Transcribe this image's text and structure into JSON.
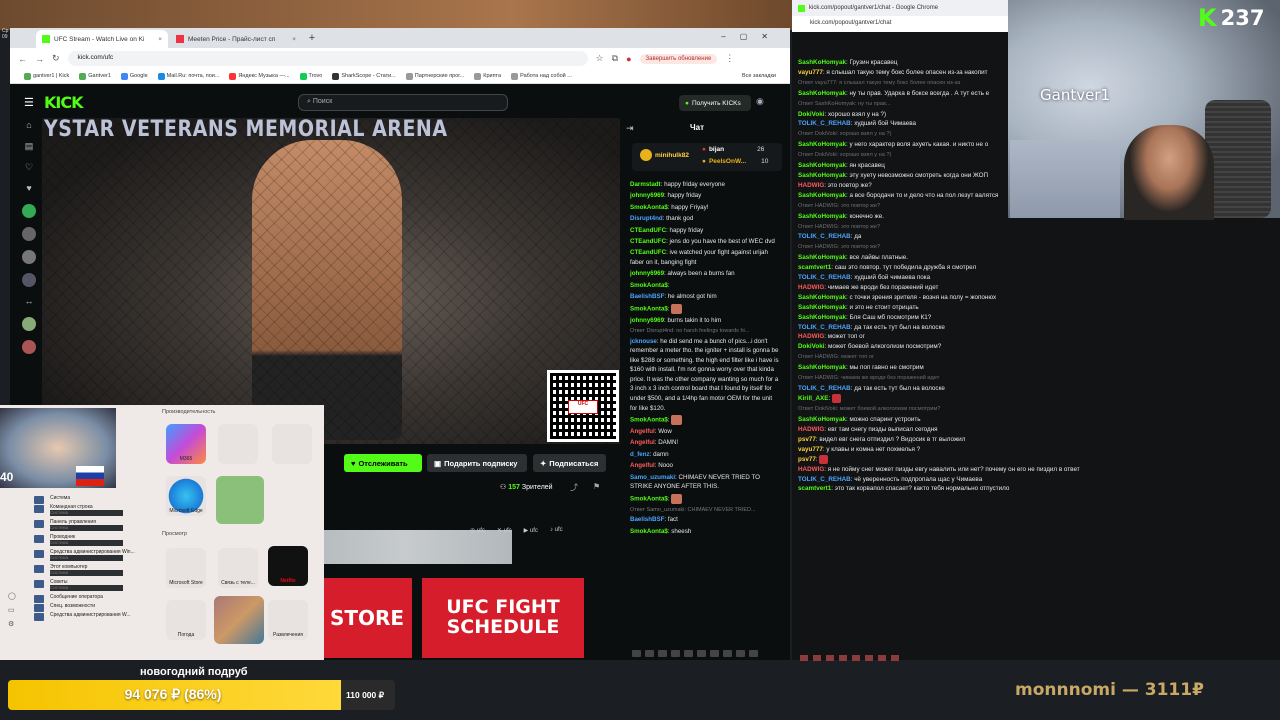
{
  "desktop": {
    "clock_line1": "Ср",
    "clock_line2": "09"
  },
  "browser": {
    "tabs": [
      {
        "label": "UFC Stream - Watch Live on Ki",
        "active": true
      },
      {
        "label": "Meeten Price - Прайс-лист сп",
        "active": false
      }
    ],
    "url": "kick.com/ufc",
    "update_button": "Завершить обновление",
    "bookmarks": [
      "gantver1 | Kick",
      "Gantver1",
      "Google",
      "Mail.Ru: почта, пои...",
      "Яндекс Музыка —...",
      "Trovo",
      "SharkScope - Стати...",
      "Партнерские прог...",
      "Крипта",
      "Работа над собой ..."
    ],
    "all_bookmarks": "Все закладки"
  },
  "kick": {
    "logo": "KICK",
    "search_placeholder": "Поиск",
    "get_kicks": "Получить KICKs",
    "get_kicks_brand": "KICKs",
    "arena_text": "YSTAR VETERANS MEMORIAL ARENA",
    "follow": "Отслеживать",
    "gift_sub": "Подарить подписку",
    "subscribe": "Подписаться",
    "viewers_count": "157",
    "viewers_label": "Зрителей",
    "socials": [
      "ufc",
      "ufc",
      "ufc",
      "ufc"
    ],
    "banner_store": "STORE",
    "banner_schedule": "UFC FIGHT SCHEDULE",
    "chat_title": "Чат",
    "gifters": [
      {
        "name": "minihulk82",
        "count": ""
      },
      {
        "name": "bijan",
        "count": "26"
      },
      {
        "name": "PeelsOnW...",
        "count": "10"
      }
    ],
    "messages": [
      {
        "user": "Darmstadt",
        "color": "#53fc18",
        "text": "happy friday everyone"
      },
      {
        "user": "johnny6969",
        "color": "#53fc18",
        "text": "happy friday"
      },
      {
        "user": "SmokAonta$",
        "color": "#53fc18",
        "text": "happy Friyay!"
      },
      {
        "user": "Disrupt4nd",
        "color": "#4aa6ff",
        "text": "thank god"
      },
      {
        "user": "CTEandUFC",
        "color": "#53fc18",
        "text": "happy friday"
      },
      {
        "user": "CTEandUFC",
        "color": "#53fc18",
        "text": "jens do you have the best of WEC dvd"
      },
      {
        "user": "CTEandUFC",
        "color": "#53fc18",
        "text": "ive watched your fight against urijah faber on it, banging fight"
      },
      {
        "user": "johnny6969",
        "color": "#53fc18",
        "text": "always been a burns fan"
      },
      {
        "user": "SmokAonta$",
        "color": "#53fc18",
        "text": ""
      },
      {
        "user": "BaelishBSF",
        "color": "#4aa6ff",
        "text": "he almost got him"
      },
      {
        "user": "SmokAonta$",
        "color": "#53fc18",
        "text": "",
        "emote": true
      },
      {
        "user": "johnny6969",
        "color": "#53fc18",
        "text": "burns takin it to him"
      },
      {
        "reply": "Ответ Disrupt4nd: no harsh feelings towards hi...",
        "user": "jcknouse",
        "color": "#4aa6ff",
        "text": "he did send me a bunch of pics...i don't remember a meter tho. the igniter + install is gonna be like $288 or something. the high end filter like i have is $160 with install. I'm not gonna worry over that kinda price. It was the other company wanting so much for a 3 inch x 3 inch control board that I found by itself for under $500, and a 1/4hp fan motor OEM for the unit for like $120."
      },
      {
        "user": "SmokAonta$",
        "color": "#53fc18",
        "text": "",
        "emote": true
      },
      {
        "user": "Angelful",
        "color": "#ff5a5a",
        "text": "Wow"
      },
      {
        "user": "Angelful",
        "color": "#ff5a5a",
        "text": "DAMN!"
      },
      {
        "user": "d_fenz",
        "color": "#4aa6ff",
        "text": "damn"
      },
      {
        "user": "Angelful",
        "color": "#ff5a5a",
        "text": "Nooo"
      },
      {
        "user": "Samo_uzumaki",
        "color": "#4aa6ff",
        "text": "CHIMAEV NEVER TRIED TO STRIKE ANYONE AFTER THIS."
      },
      {
        "user": "SmokAonta$",
        "color": "#53fc18",
        "text": "",
        "emote": true
      },
      {
        "reply": "Ответ Samo_uzumaki: CHIMAEV NEVER TRIED...",
        "user": "BaelishBSF",
        "color": "#4aa6ff",
        "text": "fact"
      },
      {
        "user": "SmokAonta$",
        "color": "#53fc18",
        "text": "sheesh"
      }
    ]
  },
  "popout": {
    "window_title": "kick.com/popout/gantver1/chat - Google Chrome",
    "url": "kick.com/popout/gantver1/chat",
    "messages": [
      {
        "user": "SashKoHomyak",
        "color": "#53fc18",
        "text": "Грузин красавец"
      },
      {
        "user": "vayu777",
        "color": "#ffd23f",
        "text": "я слышал такую тему бокс более опасен из-за накопит"
      },
      {
        "reply": "Ответ vayu777: я слышал такую тему бокс более опасен из-за"
      },
      {
        "user": "SashKoHomyak",
        "color": "#53fc18",
        "text": "ну ты прав. Ударка в боксе всегда . А тут есть е"
      },
      {
        "reply": "Ответ SashKoHomyak: ну ты прав..."
      },
      {
        "user": "DokiVoki",
        "color": "#53fc18",
        "text": "хорошо взял у на ?)"
      },
      {
        "user": "TOLIK_C_REHAB",
        "color": "#4aa6ff",
        "text": "худший бой Чимаева"
      },
      {
        "reply": "Ответ DokiVoki: хорошо взял у на ?)"
      },
      {
        "user": "SashKoHomyak",
        "color": "#53fc18",
        "text": "у него характер воля ахуеть какая. и никто не о"
      },
      {
        "reply": "Ответ DokiVoki: хорошо взял у на ?)"
      },
      {
        "user": "SashKoHomyak",
        "color": "#53fc18",
        "text": "ян красавец"
      },
      {
        "user": "SashKoHomyak",
        "color": "#53fc18",
        "text": "эту хуету невозможно смотреть когда они ЖОП"
      },
      {
        "user": "HADWIG",
        "color": "#ff5a5a",
        "text": "это повтор же?"
      },
      {
        "user": "SashKoHomyak",
        "color": "#53fc18",
        "text": "а все бородачи то и дело что на пол лезут валятся"
      },
      {
        "reply": "Ответ HADWIG: это повтор же?"
      },
      {
        "user": "SashKoHomyak",
        "color": "#53fc18",
        "text": "конечно же."
      },
      {
        "reply": "Ответ HADWIG: это повтор же?"
      },
      {
        "user": "TOLIK_C_REHAB",
        "color": "#4aa6ff",
        "text": "да"
      },
      {
        "reply": "Ответ HADWIG: это повтор же?"
      },
      {
        "user": "SashKoHomyak",
        "color": "#53fc18",
        "text": "все лайвы платные."
      },
      {
        "user": "scamtvert1",
        "color": "#53fc18",
        "text": "саш это повтор. тут победила дружба я смотрел"
      },
      {
        "user": "TOLIK_C_REHAB",
        "color": "#4aa6ff",
        "text": "худший бой чимаева пока"
      },
      {
        "user": "HADWIG",
        "color": "#ff5a5a",
        "text": "чимаев же вроди без поражений идет"
      },
      {
        "user": "SashKoHomyak",
        "color": "#53fc18",
        "text": "с точки зрения зрителя - возня на полу = жопонюх"
      },
      {
        "user": "SashKoHomyak",
        "color": "#53fc18",
        "text": "и это не стоит отрицать"
      },
      {
        "user": "SashKoHomyak",
        "color": "#53fc18",
        "text": "Бля Саш мб посмотрим К1?"
      },
      {
        "user": "TOLIK_C_REHAB",
        "color": "#4aa6ff",
        "text": "да так есть тут был на волоске"
      },
      {
        "user": "HADWIG",
        "color": "#ff5a5a",
        "text": "может топ ог"
      },
      {
        "user": "DokiVoki",
        "color": "#53fc18",
        "text": "может боевой алкоголизм посмотрим?"
      },
      {
        "reply": "Ответ HADWIG: может топ ог"
      },
      {
        "user": "SashKoHomyak",
        "color": "#53fc18",
        "text": "мы поп гавно не смотрим"
      },
      {
        "reply": "Ответ HADWIG: чимаев же вроди без поражений идет"
      },
      {
        "user": "TOLIK_C_REHAB",
        "color": "#4aa6ff",
        "text": "да так есть тут был на волоске"
      },
      {
        "user": "Kirill_AXE",
        "color": "#53fc18",
        "text": "",
        "emote": true
      },
      {
        "reply": "Ответ DokiVoki: может боевой алкоголизм посмотрим?"
      },
      {
        "user": "SashKoHomyak",
        "color": "#53fc18",
        "text": "можно спаринг устроить"
      },
      {
        "user": "HADWIG",
        "color": "#ff5a5a",
        "text": "евг там снегу пизды выписал сегодня"
      },
      {
        "user": "psv77",
        "color": "#ffd23f",
        "text": "видел евг снега отпиздил ? Видосик в тг выложил"
      },
      {
        "user": "vayu777",
        "color": "#ffd23f",
        "text": "у клавы и комна нет похмелья ?"
      },
      {
        "user": "psv77",
        "color": "#ffd23f",
        "text": "",
        "emote": true
      },
      {
        "user": "HADWIG",
        "color": "#ff5a5a",
        "text": "я не пойму снег может пизды евгу навалить или нет? почему он его не пиздил в ответ"
      },
      {
        "user": "TOLIK_C_REHAB",
        "color": "#4aa6ff",
        "text": "чё уверенность подпропала щас у Чимаева"
      },
      {
        "user": "scamtvert1",
        "color": "#53fc18",
        "text": "это так корвапол спасает? както тебя нормально отпустило"
      }
    ]
  },
  "stream_overlay": {
    "kicks_count": "237",
    "streamer_name": "Gantver1",
    "fundraiser_title": "новогодний подруб",
    "fundraiser_progress": "94 076 ₽ (86%)",
    "fundraiser_fraction": 0.86,
    "fundraiser_target": "110 000 ₽",
    "last_donor": "monnnomi — 3111₽",
    "side_cam_number": "40"
  },
  "start_menu": {
    "pinned_header": "Производительность",
    "recommended_header": "Просмотр",
    "tiles": [
      {
        "label": "M365"
      },
      {
        "label": "Microsoft Edge"
      },
      {
        "label": "Microsoft Store"
      },
      {
        "label": "Связь с теле..."
      },
      {
        "label": "Netflix"
      },
      {
        "label": "Погода"
      },
      {
        "label": "Развлечения"
      }
    ],
    "list": [
      {
        "title": "Система",
        "sub": ""
      },
      {
        "title": "Командная строка",
        "sub": "Система"
      },
      {
        "title": "Панель управления",
        "sub": "Система"
      },
      {
        "title": "Проводник",
        "sub": "Система"
      },
      {
        "title": "Средства администрирования Win...",
        "sub": "Система"
      },
      {
        "title": "Этот компьютер",
        "sub": "Система"
      },
      {
        "title": "Советы",
        "sub": "Система"
      },
      {
        "title": "Сообщение оператора",
        "sub": ""
      },
      {
        "title": "Спец. возможности",
        "sub": ""
      },
      {
        "title": "Средства администрирования W...",
        "sub": ""
      }
    ]
  },
  "colors": {
    "kick_green": "#53fc18",
    "fund_yellow": "#f5c400",
    "ufc_red": "#d51d2b"
  }
}
